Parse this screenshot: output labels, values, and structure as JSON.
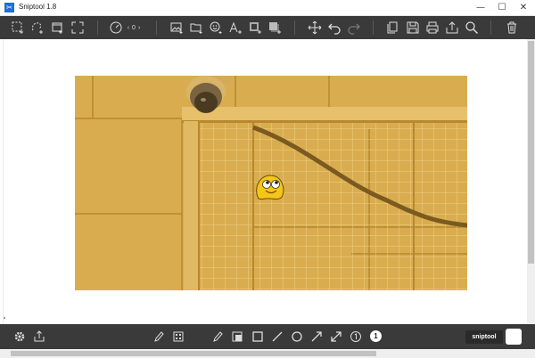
{
  "window": {
    "title": "Sniptool 1.8",
    "minimize": "—",
    "maximize": "☐",
    "close": "✕",
    "app_icon": "✂"
  },
  "top_toolbar": {
    "delay_value": "0",
    "icons": [
      "rect-capture-icon",
      "freeform-capture-icon",
      "window-capture-icon",
      "fullscreen-capture-icon",
      "timer-icon",
      "image-icon",
      "open-icon",
      "stamp-icon",
      "text-size-icon",
      "border-icon",
      "shadow-icon",
      "move-icon",
      "undo-icon",
      "redo-icon",
      "copy-icon",
      "save-icon",
      "print-icon",
      "share-icon",
      "search-icon",
      "delete-icon"
    ]
  },
  "bottom_toolbar": {
    "brand": "sniptool",
    "counter_badge": "1",
    "icons": [
      "settings-icon",
      "export-icon",
      "highlighter-icon",
      "blur-icon",
      "pen-icon",
      "fill-rect-icon",
      "rect-icon",
      "line-icon",
      "ellipse-icon",
      "arrow-icon",
      "double-arrow-icon",
      "number-icon",
      "number-badge-icon",
      "color-swatch"
    ]
  },
  "colors": {
    "toolbar": "#3a3a3a",
    "image_tint": "#d9ad4f",
    "emoji": "#f5c51a"
  }
}
